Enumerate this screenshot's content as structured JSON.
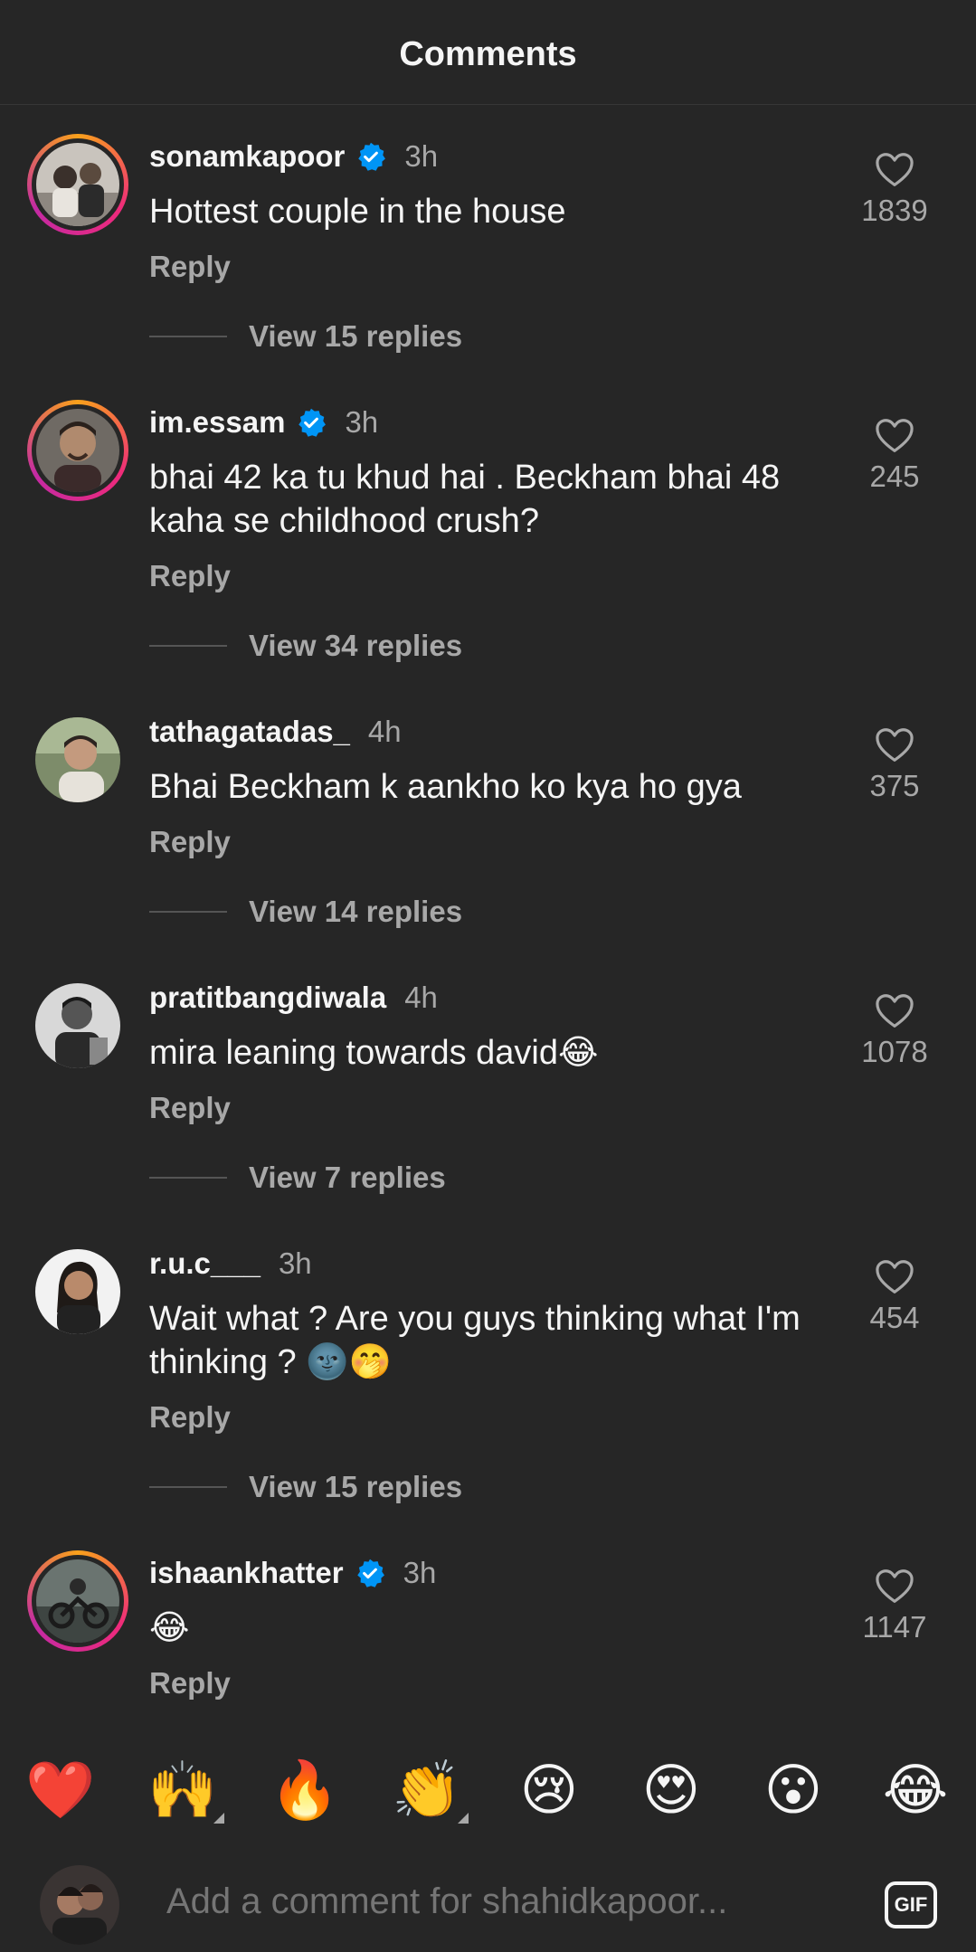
{
  "header": {
    "title": "Comments"
  },
  "comments": [
    {
      "username": "sonamkapoor",
      "verified": true,
      "time": "3h",
      "text": "Hottest couple in the house",
      "likes": "1839",
      "reply_label": "Reply",
      "view_replies": "View 15 replies",
      "avatar": "couple-photo",
      "story_ring": true
    },
    {
      "username": "im.essam",
      "verified": true,
      "time": "3h",
      "text": "bhai 42 ka tu khud hai . Beckham bhai 48 kaha se childhood crush?",
      "likes": "245",
      "reply_label": "Reply",
      "view_replies": "View 34 replies",
      "avatar": "man-portrait",
      "story_ring": true
    },
    {
      "username": "tathagatadas_",
      "verified": false,
      "time": "4h",
      "text": "Bhai Beckham k aankho ko kya ho gya",
      "likes": "375",
      "reply_label": "Reply",
      "view_replies": "View 14 replies",
      "avatar": "man-outdoor",
      "story_ring": false
    },
    {
      "username": "pratitbangdiwala",
      "verified": false,
      "time": "4h",
      "text": "mira leaning towards david😂",
      "likes": "1078",
      "reply_label": "Reply",
      "view_replies": "View 7 replies",
      "avatar": "man-bw",
      "story_ring": false
    },
    {
      "username": "r.u.c___",
      "verified": false,
      "time": "3h",
      "text": "Wait what ? Are you guys thinking what I'm thinking ? 🌚🤭",
      "likes": "454",
      "reply_label": "Reply",
      "view_replies": "View 15 replies",
      "avatar": "woman-portrait",
      "story_ring": false
    },
    {
      "username": "ishaankhatter",
      "verified": true,
      "time": "3h",
      "text": "😂",
      "likes": "1147",
      "reply_label": "Reply",
      "view_replies": "",
      "avatar": "motorbike-photo",
      "story_ring": true
    }
  ],
  "emoji_bar": [
    "❤️",
    "🙌",
    "🔥",
    "👏",
    "😢",
    "😍",
    "😮",
    "😂"
  ],
  "composer": {
    "placeholder": "Add a comment for shahidkapoor...",
    "gif_label": "GIF"
  },
  "colors": {
    "background": "#262626",
    "verified": "#0095f6",
    "muted_text": "#a8a8a8"
  }
}
